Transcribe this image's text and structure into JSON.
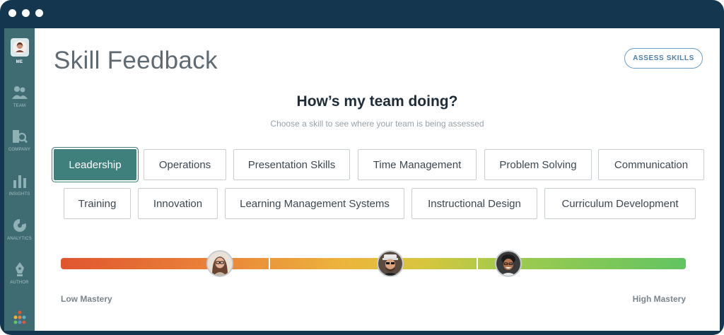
{
  "sidebar": {
    "items": [
      {
        "label": "ME",
        "icon": "user-avatar"
      },
      {
        "label": "TEAM",
        "icon": "team-icon"
      },
      {
        "label": "COMPANY",
        "icon": "company-search-icon"
      },
      {
        "label": "INSIGHTS",
        "icon": "bar-chart-icon"
      },
      {
        "label": "ANALYTICS",
        "icon": "pie-chart-icon"
      },
      {
        "label": "AUTHOR",
        "icon": "pen-icon"
      }
    ]
  },
  "header": {
    "title": "Skill Feedback",
    "assess_button": "ASSESS SKILLS"
  },
  "main": {
    "headline": "How’s my team doing?",
    "subtitle": "Choose a skill to see where your team is being assessed",
    "skills": [
      {
        "label": "Leadership",
        "selected": true
      },
      {
        "label": "Operations",
        "selected": false
      },
      {
        "label": "Presentation Skills",
        "selected": false
      },
      {
        "label": "Time Management",
        "selected": false
      },
      {
        "label": "Problem Solving",
        "selected": false
      },
      {
        "label": "Communication",
        "selected": false
      },
      {
        "label": "Training",
        "selected": false
      },
      {
        "label": "Innovation",
        "selected": false
      },
      {
        "label": "Learning Management Systems",
        "selected": false
      },
      {
        "label": "Instructional Design",
        "selected": false
      },
      {
        "label": "Curriculum Development",
        "selected": false
      }
    ],
    "mastery_scale": {
      "low_label": "Low Mastery",
      "high_label": "High Mastery",
      "team_positions": [
        0.255,
        0.527,
        0.716
      ]
    }
  },
  "colors": {
    "accent": "#3f7f7c",
    "sidebar": "#3f6b72",
    "frame": "#14374f",
    "button_border": "#6b9ec6",
    "scale_low": "#e0562f",
    "scale_high": "#62c462"
  }
}
